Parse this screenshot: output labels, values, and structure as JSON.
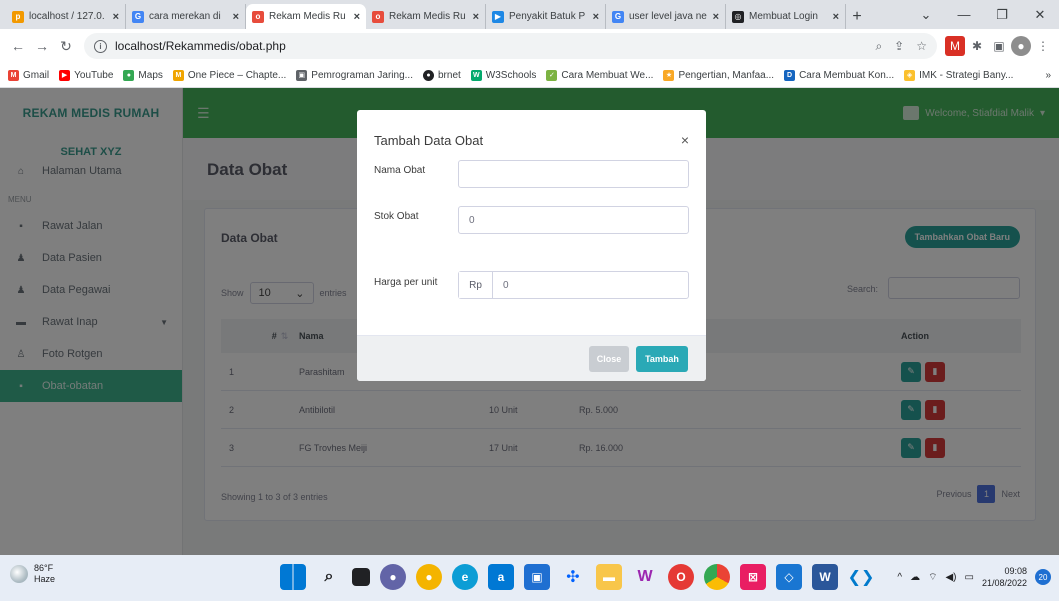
{
  "browser": {
    "tabs": [
      {
        "label": "localhost / 127.0.",
        "color": "#f29900",
        "glyph": "p"
      },
      {
        "label": "cara merekan di",
        "color": "#4285f4",
        "glyph": "G"
      },
      {
        "label": "Rekam Medis Ru",
        "color": "#e74c3c",
        "glyph": "o",
        "active": true
      },
      {
        "label": "Rekam Medis Ru",
        "color": "#e74c3c",
        "glyph": "o"
      },
      {
        "label": "Penyakit Batuk P",
        "color": "#1e88e5",
        "glyph": "▶"
      },
      {
        "label": "user level java ne",
        "color": "#4285f4",
        "glyph": "G"
      },
      {
        "label": "Membuat Login",
        "color": "#202124",
        "glyph": "◎"
      }
    ],
    "url": "localhost/Rekammedis/obat.php",
    "bookmarks": [
      {
        "label": "Gmail",
        "color": "#ea4335",
        "glyph": "M"
      },
      {
        "label": "YouTube",
        "color": "#ff0000",
        "glyph": "▶"
      },
      {
        "label": "Maps",
        "color": "#34a853",
        "glyph": "●"
      },
      {
        "label": "One Piece – Chapte...",
        "color": "#f0a500",
        "glyph": "M"
      },
      {
        "label": "Pemrograman Jaring...",
        "color": "#5f6368",
        "glyph": "▣"
      },
      {
        "label": "brnet",
        "color": "#202124",
        "glyph": "●"
      },
      {
        "label": "W3Schools",
        "color": "#04aa6d",
        "glyph": "W"
      },
      {
        "label": "Cara Membuat We...",
        "color": "#7cb342",
        "glyph": "✓"
      },
      {
        "label": "Pengertian, Manfaa...",
        "color": "#f9a825",
        "glyph": "★"
      },
      {
        "label": "Cara Membuat Kon...",
        "color": "#1565c0",
        "glyph": "D"
      },
      {
        "label": "IMK - Strategi Bany...",
        "color": "#fbc02d",
        "glyph": "◈"
      }
    ],
    "bookmarks_more": "»"
  },
  "sidebar": {
    "brand_line1": "REKAM MEDIS RUMAH",
    "brand_line2": "SEHAT XYZ",
    "home": "Halaman Utama",
    "menu_label": "MENU",
    "items": [
      {
        "label": "Rawat Jalan",
        "icon": "▪"
      },
      {
        "label": "Data Pasien",
        "icon": "♟"
      },
      {
        "label": "Data Pegawai",
        "icon": "♟"
      },
      {
        "label": "Rawat Inap",
        "icon": "▬"
      },
      {
        "label": "Foto Rotgen",
        "icon": "♙"
      },
      {
        "label": "Obat-obatan",
        "icon": "▪"
      }
    ]
  },
  "topbar": {
    "welcome": "Welcome, Stiafdial Malik"
  },
  "page": {
    "title": "Data Obat",
    "card_title": "Data Obat",
    "add_button": "Tambahkan Obat Baru",
    "show_label": "Show",
    "entries_value": "10",
    "entries_label": "entries",
    "search_label": "Search:",
    "columns": {
      "no": "#",
      "name": "Nama",
      "action": "Action"
    },
    "rows": [
      {
        "no": "1",
        "name": "Parashitam",
        "stock": "",
        "price": ""
      },
      {
        "no": "2",
        "name": "Antibilotil",
        "stock": "10 Unit",
        "price": "Rp. 5.000"
      },
      {
        "no": "3",
        "name": "FG Trovhes Meiji",
        "stock": "17 Unit",
        "price": "Rp. 16.000"
      }
    ],
    "showing": "Showing 1 to 3 of 3 entries",
    "pager": {
      "prev": "Previous",
      "current": "1",
      "next": "Next"
    }
  },
  "modal": {
    "title": "Tambah Data Obat",
    "close_icon": "×",
    "name_label": "Nama Obat",
    "name_value": "",
    "stock_label": "Stok Obat",
    "stock_value": "0",
    "price_label": "Harga per unit",
    "price_prefix": "Rp",
    "price_value": "0",
    "close_button": "Close",
    "submit_button": "Tambah"
  },
  "taskbar": {
    "temp": "86°F",
    "condition": "Haze",
    "time": "09:08",
    "date": "21/08/2022",
    "notifications": "20"
  }
}
